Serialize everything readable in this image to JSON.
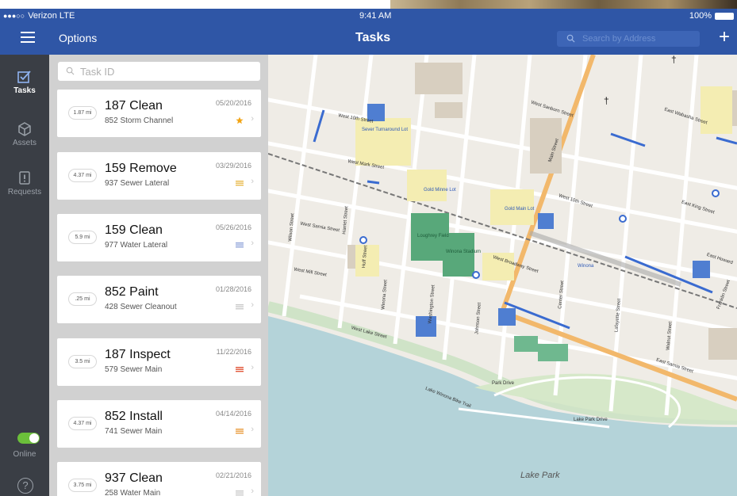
{
  "status_bar": {
    "carrier": "Verizon  LTE",
    "signal_dots": "●●●○○",
    "time": "9:41 AM",
    "battery": "100%"
  },
  "nav": {
    "options_label": "Options",
    "title": "Tasks",
    "search_placeholder": "Search by Address"
  },
  "rail": {
    "items": [
      {
        "label": "Tasks",
        "icon": "tasks-icon",
        "active": true
      },
      {
        "label": "Assets",
        "icon": "cube-icon",
        "active": false
      },
      {
        "label": "Requests",
        "icon": "alert-icon",
        "active": false
      }
    ],
    "online_label": "Online",
    "online": true,
    "help_symbol": "?"
  },
  "task_search": {
    "placeholder": "Task ID"
  },
  "tasks": [
    {
      "distance": "1.87 mi",
      "name": "187 Clean",
      "asset": "852 Storm Channel",
      "date": "05/20/2016",
      "priority": "star"
    },
    {
      "distance": "4.37 mi",
      "name": "159 Remove",
      "asset": "937 Sewer Lateral",
      "date": "03/29/2016",
      "priority": "medium"
    },
    {
      "distance": "5.9 mi",
      "name": "159 Clean",
      "asset": "977 Water Lateral",
      "date": "05/26/2016",
      "priority": "low"
    },
    {
      "distance": ".25 mi",
      "name": "852 Paint",
      "asset": "428 Sewer Cleanout",
      "date": "01/28/2016",
      "priority": "none"
    },
    {
      "distance": "3.5 mi",
      "name": "187 Inspect",
      "asset": "579 Sewer Main",
      "date": "11/22/2016",
      "priority": "high"
    },
    {
      "distance": "4.37 mi",
      "name": "852 Install",
      "asset": "741 Sewer Main",
      "date": "04/14/2016",
      "priority": "medium-high"
    },
    {
      "distance": "3.75 mi",
      "name": "937 Clean",
      "asset": "258 Water Main",
      "date": "02/21/2016",
      "priority": "none"
    }
  ],
  "colors": {
    "brand": "#2f56a6",
    "rail": "#3a3e45",
    "online": "#6bbf3a",
    "star": "#f2a414",
    "high": "#e2573a",
    "medium": "#e8b94a",
    "low": "#8ea2d8",
    "none": "#c9c9c9"
  },
  "map": {
    "street_labels": [
      "West 10th Street",
      "West Mark Street",
      "West Sarnia Street",
      "West Mill Street",
      "Main Street",
      "West Sanborn Street",
      "East Wabasha Street",
      "East King Street",
      "West 10th Street",
      "West Broadway Street",
      "East Sarnia Street",
      "Park Drive",
      "Lake Park Drive",
      "West Lake Street",
      "Huff Street",
      "Johnson Street",
      "Washington Street",
      "Winona Street",
      "Center Street",
      "Lafayette Street",
      "Walnut Street",
      "Franklin Street",
      "East Howard",
      "Harriet Street",
      "Wilson Street",
      "Lake Winona Bike Trail"
    ],
    "poi_labels": [
      "Sever Turnaround Lot",
      "Gold Minne Lot",
      "Gold Main Lot",
      "Winona",
      "Loughrey Field",
      "Winona Stadium"
    ],
    "area_label": "Lake Park"
  }
}
